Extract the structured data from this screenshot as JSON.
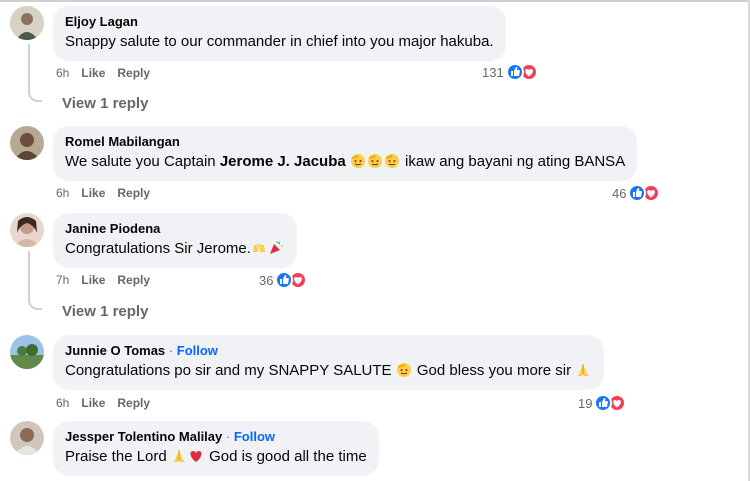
{
  "comments": [
    {
      "author": "Eljoy Lagan",
      "text": "Snappy salute to our commander in chief into you major hakuba.",
      "time": "6h",
      "like_label": "Like",
      "reply_label": "Reply",
      "reaction_count": "131",
      "reactions": [
        "like-icon",
        "love-icon"
      ],
      "view_replies": "View 1 reply"
    },
    {
      "author": "Romel Mabilangan",
      "text_before": "We salute you Captain ",
      "text_bold": "Jerome J. Jacuba",
      "text_after": " ikaw ang bayani ng ating BANSA",
      "emojis": [
        "saluting-face-emoji",
        "saluting-face-emoji",
        "saluting-face-emoji"
      ],
      "time": "6h",
      "like_label": "Like",
      "reply_label": "Reply",
      "reaction_count": "46",
      "reactions": [
        "like-icon",
        "love-icon"
      ]
    },
    {
      "author": "Janine Piodena",
      "text": "Congratulations Sir Jerome.",
      "emojis": [
        "raising-hands-emoji",
        "party-popper-emoji"
      ],
      "time": "7h",
      "like_label": "Like",
      "reply_label": "Reply",
      "reaction_count": "36",
      "reactions": [
        "like-icon",
        "love-icon"
      ],
      "view_replies": "View 1 reply"
    },
    {
      "author": "Junnie O Tomas",
      "follow_label": "Follow",
      "text_before": "Congratulations po sir and my SNAPPY SALUTE ",
      "text_middle": " God bless you more sir ",
      "emojis": [
        "saluting-face-emoji",
        "folded-hands-emoji"
      ],
      "time": "6h",
      "like_label": "Like",
      "reply_label": "Reply",
      "reaction_count": "19",
      "reactions": [
        "like-icon",
        "love-icon"
      ]
    },
    {
      "author": "Jessper Tolentino Malilay",
      "follow_label": "Follow",
      "text_before": "Praise the Lord ",
      "text_after": " God is good all the time",
      "emojis": [
        "folded-hands-emoji",
        "red-heart-emoji"
      ]
    }
  ],
  "separator": "·",
  "colors": {
    "bubble_bg": "#f0f2f5",
    "follow_link": "#0866ff",
    "secondary_text": "#65676b",
    "like_blue": "#1877f2",
    "love_red": "#f33e58"
  }
}
